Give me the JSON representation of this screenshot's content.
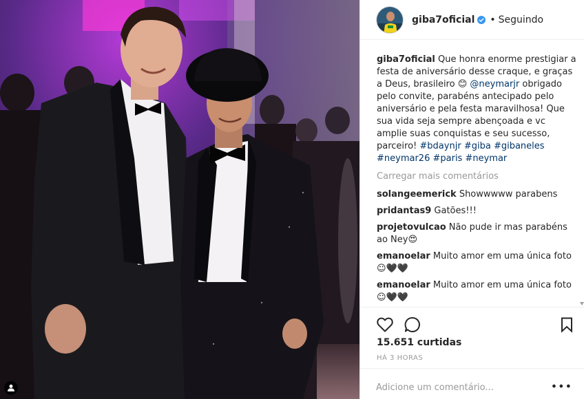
{
  "post": {
    "username": "giba7oficial",
    "follow_label": "Seguindo",
    "caption_parts": [
      {
        "type": "text",
        "value": "Que honra enorme prestigiar a festa de aniversário desse craque, e graças a Deus, brasileiro 😊 "
      },
      {
        "type": "link",
        "value": "@neymarjr"
      },
      {
        "type": "text",
        "value": " obrigado pelo convite, parabéns antecipado pelo aniversário e pela festa maravilhosa! Que sua vida seja sempre abençoada e vc amplie suas conquistas e seu sucesso, parceiro! "
      },
      {
        "type": "link",
        "value": "#bdaynjr"
      },
      {
        "type": "text",
        "value": " "
      },
      {
        "type": "link",
        "value": "#giba"
      },
      {
        "type": "text",
        "value": " "
      },
      {
        "type": "link",
        "value": "#gibaneles"
      },
      {
        "type": "text",
        "value": " "
      },
      {
        "type": "link",
        "value": "#neymar26"
      },
      {
        "type": "text",
        "value": " "
      },
      {
        "type": "link",
        "value": "#paris"
      },
      {
        "type": "text",
        "value": " "
      },
      {
        "type": "link",
        "value": "#neymar"
      }
    ],
    "load_more_label": "Carregar mais comentários",
    "comments": [
      {
        "user": "solangeemerick",
        "text": "Showwwww parabens"
      },
      {
        "user": "pridantas9",
        "text": "Gatões!!!"
      },
      {
        "user": "projetovulcao",
        "text": "Não pude ir mas parabéns ao Ney😍"
      },
      {
        "user": "emanoelar",
        "text": "Muito amor em uma única foto ☺🖤🖤"
      },
      {
        "user": "emanoelar",
        "text": "Muito amor em uma única foto ☺🖤🖤"
      }
    ],
    "likes_label": "15.651 curtidas",
    "time_label": "HÁ 3 HORAS",
    "add_comment_placeholder": "Adicione um comentário...",
    "more_options": "•••"
  },
  "icons": {
    "verified": "verified-badge-icon",
    "like": "heart-icon",
    "comment": "comment-bubble-icon",
    "save": "bookmark-icon",
    "tag": "person-tag-icon"
  },
  "colors": {
    "link": "#003569",
    "muted": "#999999",
    "verified": "#3897f0",
    "text": "#262626"
  }
}
